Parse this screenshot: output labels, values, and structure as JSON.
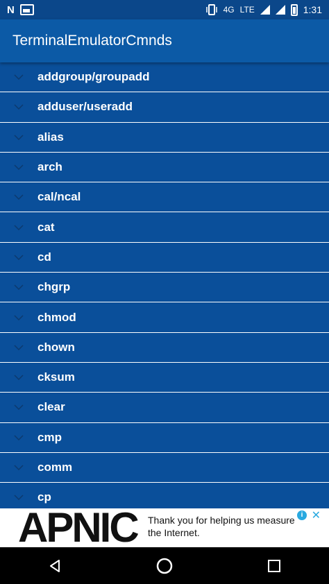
{
  "status": {
    "n_icon": "N",
    "network": "4G",
    "lte": "LTE",
    "time": "1:31"
  },
  "appbar": {
    "title": "TerminalEmulatorCmnds"
  },
  "commands": [
    "addgroup/groupadd",
    "adduser/useradd",
    "alias",
    "arch",
    "cal/ncal",
    "cat",
    "cd",
    "chgrp",
    "chmod",
    "chown",
    "cksum",
    "clear",
    "cmp",
    "comm",
    "cp"
  ],
  "ad": {
    "logo": "APNIC",
    "text": "Thank you for helping us measure the Internet.",
    "info": "i",
    "close": "✕"
  },
  "colors": {
    "list_bg": "#0a4f9a",
    "appbar_bg": "#0c5aa6",
    "divider": "#ffffff"
  }
}
